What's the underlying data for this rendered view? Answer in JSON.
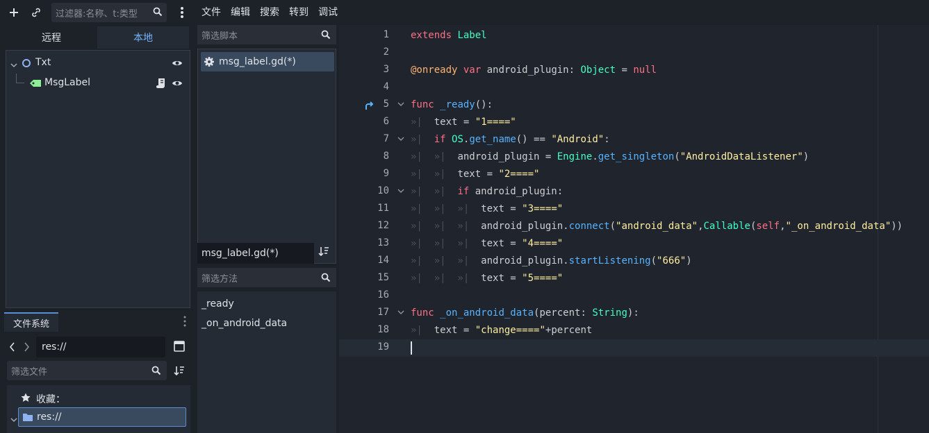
{
  "left_dock": {
    "filter_placeholder": "过滤器:名称、t:类型",
    "tab_remote": "远程",
    "tab_local": "本地",
    "tree": [
      {
        "label": "Txt"
      },
      {
        "label": "MsgLabel"
      }
    ],
    "filesystem_tab": "文件系统",
    "path": "res://",
    "file_filter_placeholder": "筛选文件",
    "favorites_label": "收藏：",
    "res_folder": "res://"
  },
  "menu": {
    "items": [
      "文件",
      "编辑",
      "搜索",
      "转到",
      "调试"
    ]
  },
  "script_panel": {
    "filter_scripts_placeholder": "筛选脚本",
    "script_item": "msg_label.gd(*)",
    "current_script": "msg_label.gd(*)",
    "filter_methods_placeholder": "筛选方法",
    "methods": [
      "_ready",
      "_on_android_data"
    ]
  },
  "editor": {
    "line_numbers": [
      "1",
      "2",
      "3",
      "4",
      "5",
      "6",
      "7",
      "8",
      "9",
      "10",
      "11",
      "12",
      "13",
      "14",
      "15",
      "16",
      "17",
      "18",
      "19"
    ]
  },
  "colors": {
    "keyword": "#ff7085",
    "type": "#42ffc2",
    "function": "#57b3ff",
    "string": "#ffeda1",
    "annotation": "#ffb373",
    "accent": "#73b3ff"
  }
}
